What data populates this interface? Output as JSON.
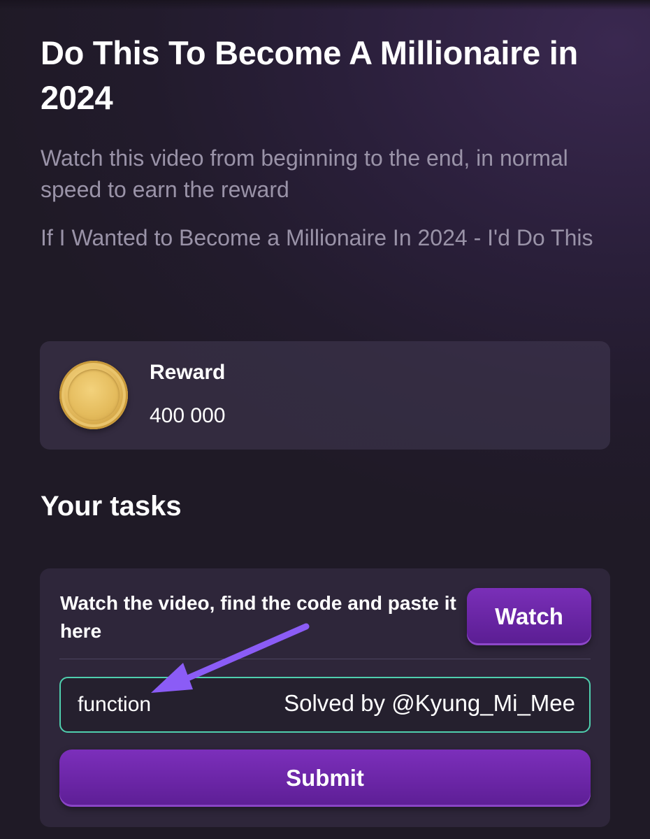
{
  "header": {
    "title": "Do This To Become A Millionaire in 2024",
    "description": "Watch this video from beginning to the end, in normal speed to earn the reward",
    "video_title": "If I Wanted to Become a Millionaire In 2024 - I'd Do This"
  },
  "reward": {
    "label": "Reward",
    "value": "400 000",
    "icon": "coin-icon"
  },
  "tasks": {
    "heading": "Your tasks",
    "task_text": "Watch the video, find the code and paste it here",
    "watch_label": "Watch",
    "code_value": "function",
    "submit_label": "Submit"
  },
  "annotation": {
    "watermark_text": "Solved by @Kyung_Mi_Mee",
    "arrow_color": "#8b5cf6"
  },
  "colors": {
    "accent_purple": "#6a26a6",
    "input_border": "#4fcfae",
    "muted_text": "#9a93a8"
  }
}
